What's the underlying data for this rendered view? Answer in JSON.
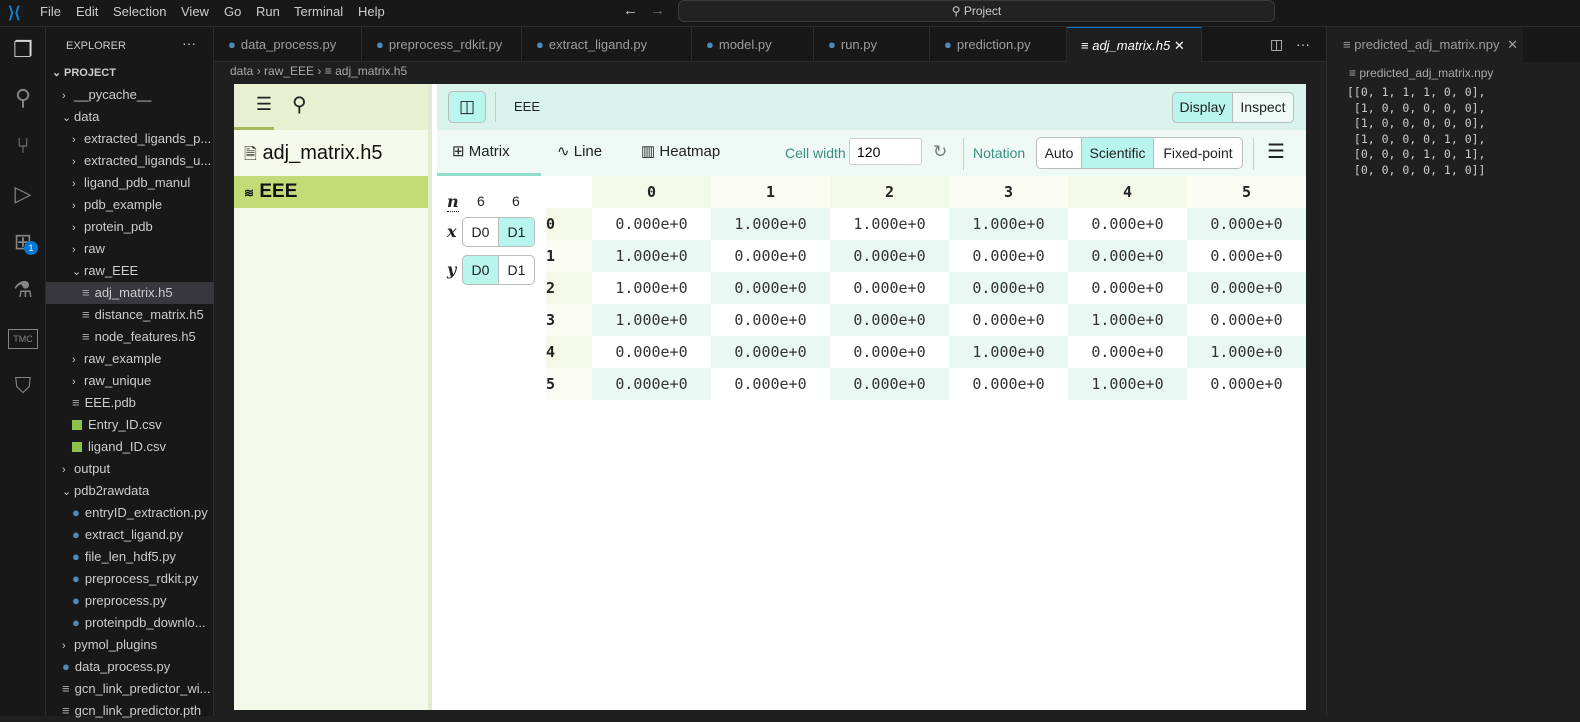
{
  "menu": [
    "File",
    "Edit",
    "Selection",
    "View",
    "Go",
    "Run",
    "Terminal",
    "Help"
  ],
  "command_center": "Project",
  "explorer": {
    "title": "EXPLORER",
    "more": "···",
    "root": "PROJECT",
    "items": [
      {
        "label": "__pycache__",
        "level": 1,
        "type": "folder",
        "open": false
      },
      {
        "label": "data",
        "level": 1,
        "type": "folder",
        "open": true
      },
      {
        "label": "extracted_ligands_p...",
        "level": 2,
        "type": "folder",
        "open": false
      },
      {
        "label": "extracted_ligands_u...",
        "level": 2,
        "type": "folder",
        "open": false
      },
      {
        "label": "ligand_pdb_manul",
        "level": 2,
        "type": "folder",
        "open": false
      },
      {
        "label": "pdb_example",
        "level": 2,
        "type": "folder",
        "open": false
      },
      {
        "label": "protein_pdb",
        "level": 2,
        "type": "folder",
        "open": false
      },
      {
        "label": "raw",
        "level": 2,
        "type": "folder",
        "open": false
      },
      {
        "label": "raw_EEE",
        "level": 2,
        "type": "folder",
        "open": true
      },
      {
        "label": "adj_matrix.h5",
        "level": 3,
        "type": "file",
        "selected": true
      },
      {
        "label": "distance_matrix.h5",
        "level": 3,
        "type": "file"
      },
      {
        "label": "node_features.h5",
        "level": 3,
        "type": "file"
      },
      {
        "label": "raw_example",
        "level": 2,
        "type": "folder",
        "open": false
      },
      {
        "label": "raw_unique",
        "level": 2,
        "type": "folder",
        "open": false
      },
      {
        "label": "EEE.pdb",
        "level": 2,
        "type": "file"
      },
      {
        "label": "Entry_ID.csv",
        "level": 2,
        "type": "csv"
      },
      {
        "label": "ligand_ID.csv",
        "level": 2,
        "type": "csv"
      },
      {
        "label": "output",
        "level": 1,
        "type": "folder",
        "open": false
      },
      {
        "label": "pdb2rawdata",
        "level": 1,
        "type": "folder",
        "open": true
      },
      {
        "label": "entryID_extraction.py",
        "level": 2,
        "type": "py"
      },
      {
        "label": "extract_ligand.py",
        "level": 2,
        "type": "py"
      },
      {
        "label": "file_len_hdf5.py",
        "level": 2,
        "type": "py"
      },
      {
        "label": "preprocess_rdkit.py",
        "level": 2,
        "type": "py"
      },
      {
        "label": "preprocess.py",
        "level": 2,
        "type": "py"
      },
      {
        "label": "proteinpdb_downlo...",
        "level": 2,
        "type": "py"
      },
      {
        "label": "pymol_plugins",
        "level": 1,
        "type": "folder",
        "open": false
      },
      {
        "label": "data_process.py",
        "level": 1,
        "type": "py"
      },
      {
        "label": "gcn_link_predictor_wi...",
        "level": 1,
        "type": "file"
      },
      {
        "label": "gcn_link_predictor.pth",
        "level": 1,
        "type": "file"
      }
    ]
  },
  "extensions_badge": "1",
  "tabs": [
    "data_process.py",
    "preprocess_rdkit.py",
    "extract_ligand.py",
    "model.py",
    "run.py",
    "prediction.py",
    "adj_matrix.h5"
  ],
  "breadcrumb": [
    "data",
    "raw_EEE",
    "adj_matrix.h5"
  ],
  "h5web": {
    "file": "adj_matrix.h5",
    "dataset": "EEE",
    "path_title": "EEE",
    "display": "Display",
    "inspect": "Inspect",
    "vis_tabs": [
      "Matrix",
      "Line",
      "Heatmap"
    ],
    "cell_width_label": "Cell width",
    "cell_width": "120",
    "notation_label": "Notation",
    "notation_options": [
      "Auto",
      "Scientific",
      "Fixed-point"
    ],
    "notation_selected": "Scientific",
    "dims": {
      "n_label": "n",
      "n": [
        "6",
        "6"
      ],
      "x_label": "x",
      "y_label": "y",
      "x_options": [
        "D0",
        "D1"
      ],
      "x_selected": "D1",
      "y_options": [
        "D0",
        "D1"
      ],
      "y_selected": "D0"
    },
    "columns": [
      "0",
      "1",
      "2",
      "3",
      "4",
      "5"
    ],
    "rows": [
      [
        "0.000e+0",
        "1.000e+0",
        "1.000e+0",
        "1.000e+0",
        "0.000e+0",
        "0.000e+0"
      ],
      [
        "1.000e+0",
        "0.000e+0",
        "0.000e+0",
        "0.000e+0",
        "0.000e+0",
        "0.000e+0"
      ],
      [
        "1.000e+0",
        "0.000e+0",
        "0.000e+0",
        "0.000e+0",
        "0.000e+0",
        "0.000e+0"
      ],
      [
        "1.000e+0",
        "0.000e+0",
        "0.000e+0",
        "0.000e+0",
        "1.000e+0",
        "0.000e+0"
      ],
      [
        "0.000e+0",
        "0.000e+0",
        "0.000e+0",
        "1.000e+0",
        "0.000e+0",
        "1.000e+0"
      ],
      [
        "0.000e+0",
        "0.000e+0",
        "0.000e+0",
        "0.000e+0",
        "1.000e+0",
        "0.000e+0"
      ]
    ]
  },
  "right_editor": {
    "tab": "predicted_adj_matrix.npy",
    "breadcrumb": "predicted_adj_matrix.npy",
    "content": "[[0, 1, 1, 1, 0, 0],\n [1, 0, 0, 0, 0, 0],\n [1, 0, 0, 0, 0, 0],\n [1, 0, 0, 0, 1, 0],\n [0, 0, 0, 1, 0, 1],\n [0, 0, 0, 0, 1, 0]]"
  }
}
